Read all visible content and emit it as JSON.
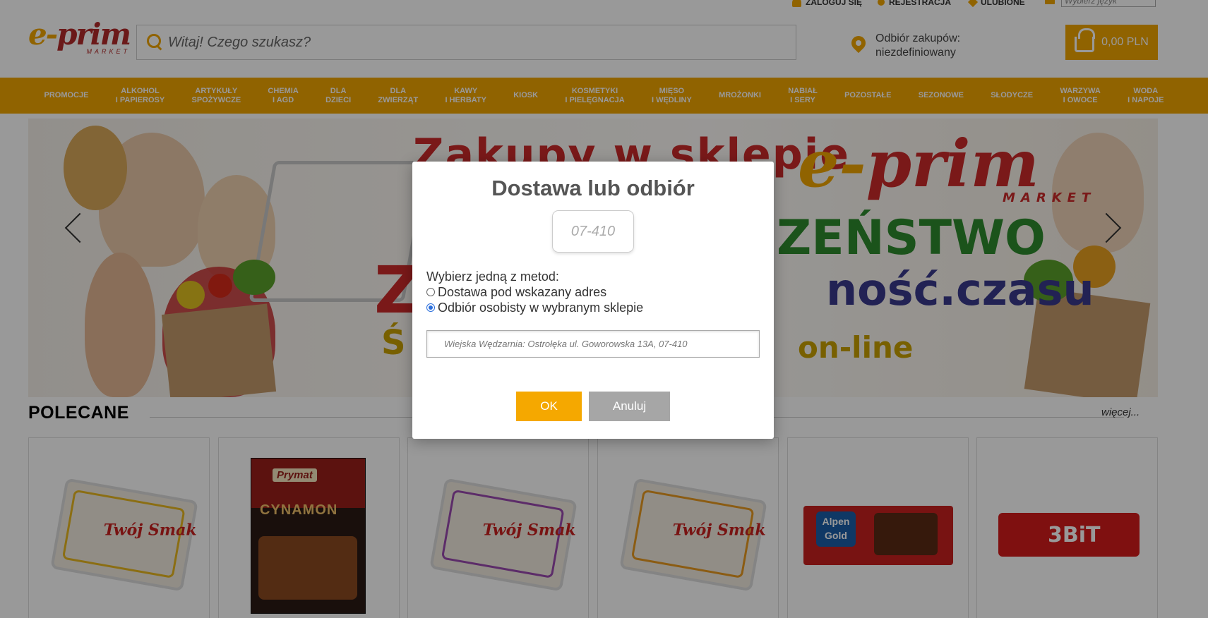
{
  "header": {
    "top_links": {
      "login": "ZALOGUJ SIĘ",
      "register": "REJESTRACJA",
      "favorites": "ULUBIONE"
    },
    "language_select_placeholder": "Wybierz język",
    "logo": {
      "e": "e-",
      "prim": "prim",
      "sub": "MARKET"
    },
    "search_placeholder": "Witaj! Czego szukasz?",
    "pickup_label": "Odbiór zakupów:",
    "pickup_value": "niezdefiniowany",
    "cart_total": "0,00 PLN"
  },
  "nav": {
    "items": [
      "PROMOCJE",
      "ALKOHOL\nI PAPIEROSY",
      "ARTYKUŁY\nSPOŻYWCZE",
      "CHEMIA\nI AGD",
      "DLA\nDZIECI",
      "DLA\nZWIERZĄT",
      "KAWY\nI HERBATY",
      "KIOSK",
      "KOSMETYKI\nI PIELĘGNACJA",
      "MIĘSO\nI WĘDLINY",
      "MROŻONKI",
      "NABIAŁ\nI SERY",
      "POZOSTAŁE",
      "SEZONOWE",
      "SŁODYCZE",
      "WARZYWA\nI OWOCE",
      "WODA\nI NAPOJE"
    ]
  },
  "banner": {
    "line_top": "Zakupy w sklepie",
    "logo_e": "e-",
    "logo_prim": "prim",
    "logo_sub": "MARKET",
    "line_mid": "ZEŃSTWO",
    "line_big": "Z",
    "line_czasu": "ność.czasu",
    "line_bottom": "Ś",
    "line_online": "on-line"
  },
  "polecane": {
    "title": "POLECANE",
    "more": "więcej...",
    "products": [
      {
        "type": "tub",
        "brand": "Twój Smak",
        "color": "#e8b820"
      },
      {
        "type": "spice",
        "brand": "Prymat",
        "name": "CYNAMON"
      },
      {
        "type": "tub",
        "brand": "Twój Smak",
        "color": "#9a4ab0"
      },
      {
        "type": "tub",
        "brand": "Twój Smak",
        "color": "#e89a20"
      },
      {
        "type": "chocolate",
        "brand": "Alpen Gold"
      },
      {
        "type": "bar",
        "brand": "3BiT"
      }
    ]
  },
  "modal": {
    "title": "Dostawa lub odbiór",
    "zip_value": "07-410",
    "methods_label": "Wybierz jedną z metod:",
    "method_delivery": "Dostawa pod wskazany adres",
    "method_pickup": "Odbiór osobisty w wybranym sklepie",
    "selected_method": "pickup",
    "store_value": "Wiejska Wędzarnia: Ostrołęka ul. Goworowska 13A, 07-410",
    "ok_label": "OK",
    "cancel_label": "Anuluj"
  },
  "colors": {
    "accent": "#f0a500",
    "brand_red": "#b22a2a",
    "ok_button": "#f5a800",
    "cancel_button": "#a6a6a6"
  }
}
